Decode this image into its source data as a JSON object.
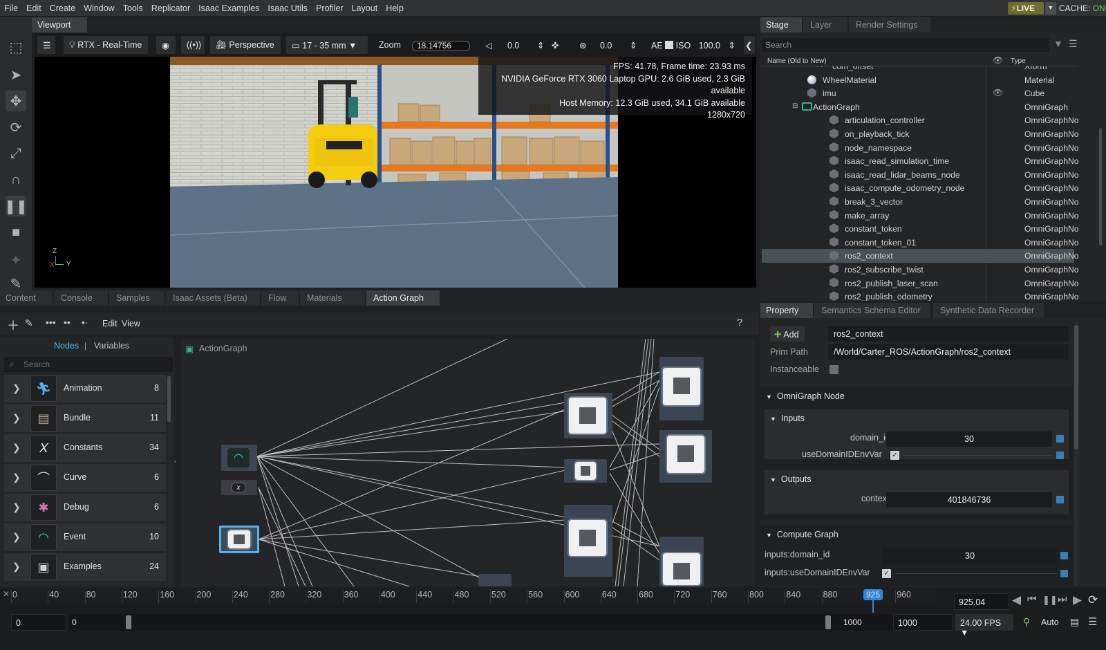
{
  "menu": [
    "File",
    "Edit",
    "Create",
    "Window",
    "Tools",
    "Replicator",
    "Isaac Examples",
    "Isaac Utils",
    "Profiler",
    "Layout",
    "Help"
  ],
  "live_label": "LIVE",
  "cache_label": "CACHE:",
  "cache_state": "ON",
  "viewport": {
    "tab": "Viewport",
    "renderer": "RTX - Real-Time",
    "camera": "Perspective",
    "lens": "17 - 35 mm",
    "zoom_label": "Zoom",
    "zoom_value": "18.14756",
    "angle_value": "0.0",
    "exposure_value": "0.0",
    "ae_label": "AE",
    "iso_label": "ISO",
    "iso_value": "100.0",
    "stats": [
      "FPS: 41.78, Frame time: 23.93 ms",
      "NVIDIA GeForce RTX 3060 Laptop GPU: 2.6 GiB used, 2.3 GiB available",
      "Host Memory: 12.3 GiB used, 34.1 GiB available",
      "1280x720"
    ],
    "axis_z": "Z",
    "axis_x": "X",
    "axis_y": "Y"
  },
  "stage": {
    "tabs": [
      "Stage",
      "Layer",
      "Render Settings"
    ],
    "search_placeholder": "Search",
    "col_name": "Name (Old to New)",
    "col_type": "Type",
    "rows": [
      {
        "name": "com_offset",
        "type": "Xform"
      },
      {
        "name": "WheelMaterial",
        "type": "Material"
      },
      {
        "name": "imu",
        "type": "Cube"
      },
      {
        "name": "ActionGraph",
        "type": "OmniGraph"
      },
      {
        "name": "articulation_controller",
        "type": "OmniGraphNode"
      },
      {
        "name": "on_playback_tick",
        "type": "OmniGraphNode"
      },
      {
        "name": "node_namespace",
        "type": "OmniGraphNode"
      },
      {
        "name": "isaac_read_simulation_time",
        "type": "OmniGraphNode"
      },
      {
        "name": "isaac_read_lidar_beams_node",
        "type": "OmniGraphNode"
      },
      {
        "name": "isaac_compute_odometry_node",
        "type": "OmniGraphNode"
      },
      {
        "name": "break_3_vector",
        "type": "OmniGraphNode"
      },
      {
        "name": "make_array",
        "type": "OmniGraphNode"
      },
      {
        "name": "constant_token",
        "type": "OmniGraphNode"
      },
      {
        "name": "constant_token_01",
        "type": "OmniGraphNode"
      },
      {
        "name": "ros2_context",
        "type": "OmniGraphNode"
      },
      {
        "name": "ros2_subscribe_twist",
        "type": "OmniGraphNode"
      },
      {
        "name": "ros2_publish_laser_scan",
        "type": "OmniGraphNode"
      },
      {
        "name": "ros2_publish_odometry",
        "type": "OmniGraphNode"
      }
    ]
  },
  "bottom_tabs": [
    "Content",
    "Console",
    "Samples",
    "Isaac Assets (Beta)",
    "Flow",
    "Materials",
    "Action Graph"
  ],
  "action_graph": {
    "edit_label": "Edit",
    "view_label": "View",
    "help": "?",
    "nodes_tab": "Nodes",
    "sep": "|",
    "variables_tab": "Variables",
    "search_placeholder": "Search",
    "graph_title": "ActionGraph",
    "categories": [
      {
        "label": "Animation",
        "count": "8"
      },
      {
        "label": "Bundle",
        "count": "11"
      },
      {
        "label": "Constants",
        "count": "34"
      },
      {
        "label": "Curve",
        "count": "6"
      },
      {
        "label": "Debug",
        "count": "6"
      },
      {
        "label": "Event",
        "count": "10"
      },
      {
        "label": "Examples",
        "count": "24"
      }
    ]
  },
  "property": {
    "tabs": [
      "Property",
      "Semantics Schema Editor",
      "Synthetic Data Recorder"
    ],
    "add_label": "Add",
    "name_value": "ros2_context",
    "prim_path_label": "Prim Path",
    "prim_path_value": "/World/Carter_ROS/ActionGraph/ros2_context",
    "instanceable_label": "Instanceable",
    "omnigraph_node": "OmniGraph Node",
    "inputs": "Inputs",
    "domain_id_label": "domain_id",
    "domain_id_value": "30",
    "use_env_label": "useDomainIDEnvVar",
    "outputs": "Outputs",
    "context_label": "context",
    "context_value": "401846736",
    "compute_graph": "Compute Graph",
    "cg_domain_label": "inputs:domain_id",
    "cg_domain_value": "30",
    "cg_env_label": "inputs:useDomainIDEnvVar"
  },
  "timeline": {
    "ticks": [
      "0",
      "40",
      "80",
      "120",
      "160",
      "200",
      "240",
      "280",
      "320",
      "360",
      "400",
      "440",
      "480",
      "520",
      "560",
      "600",
      "640",
      "680",
      "720",
      "760",
      "800",
      "840",
      "880",
      "920",
      "960"
    ],
    "marker": "925",
    "current": "925.04",
    "start": "0",
    "range_start": "0",
    "range_end": "1000",
    "end": "1000",
    "fps": "24.00 FPS",
    "auto": "Auto"
  },
  "colors": {
    "accent": "#4fb3ee",
    "live": "#6b6d35",
    "cache_on": "#77d04d",
    "selection": "#4b5256"
  }
}
